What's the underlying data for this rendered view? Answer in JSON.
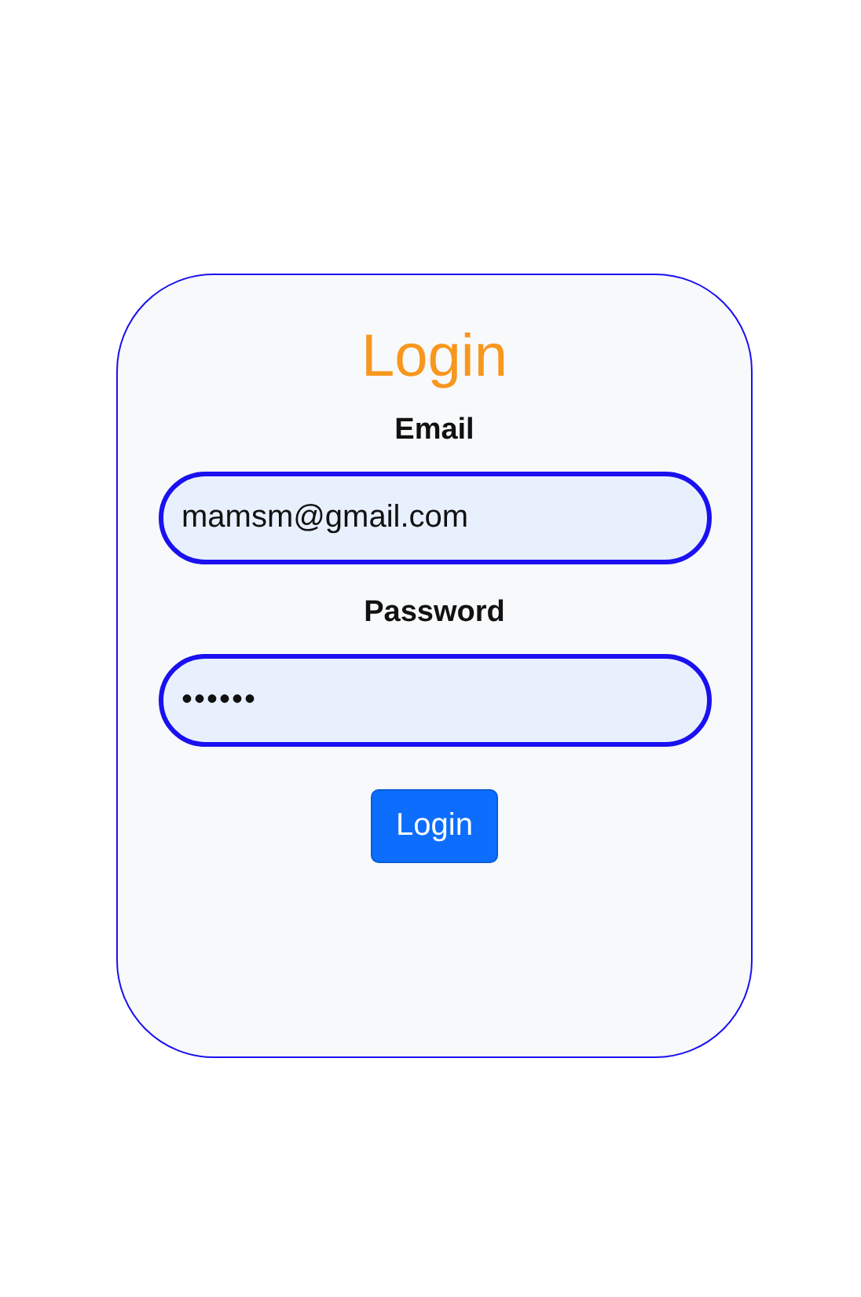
{
  "title": "Login",
  "fields": [
    {
      "label": "Email",
      "value": "mamsm@gmail.com"
    },
    {
      "label": "Password",
      "value": "••••••"
    }
  ],
  "button": "Login"
}
